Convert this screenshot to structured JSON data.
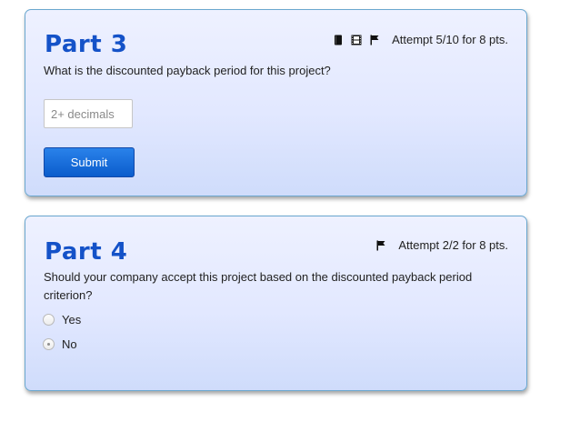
{
  "part3": {
    "title": "Part 3",
    "attempt": "Attempt 5/10 for 8 pts.",
    "question": "What is the discounted payback period for this project?",
    "input_value": "",
    "input_placeholder": "2+ decimals",
    "submit_label": "Submit",
    "icons": [
      "book-icon",
      "film-icon",
      "flag-icon"
    ]
  },
  "part4": {
    "title": "Part 4",
    "attempt": "Attempt 2/2 for 8 pts.",
    "question": "Should your company accept this project based on the discounted payback period criterion?",
    "icons": [
      "flag-icon"
    ],
    "options": [
      {
        "label": "Yes",
        "selected": false
      },
      {
        "label": "No",
        "selected": true
      }
    ]
  }
}
